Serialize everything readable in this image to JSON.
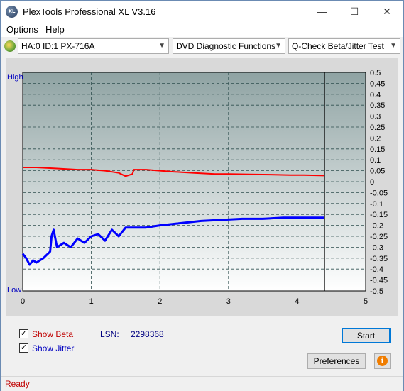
{
  "window": {
    "title": "PlexTools Professional XL V3.16",
    "icon_label": "XL",
    "minimize_glyph": "—",
    "maximize_glyph": "☐",
    "close_glyph": "✕"
  },
  "menu": {
    "options": "Options",
    "help": "Help"
  },
  "toolbar": {
    "drive": "HA:0 ID:1  PX-716A",
    "function": "DVD Diagnostic Functions",
    "test": "Q-Check Beta/Jitter Test"
  },
  "chart_data": {
    "type": "line",
    "left_axis_top_label": "High",
    "left_axis_bottom_label": "Low",
    "x_ticks": [
      "0",
      "1",
      "2",
      "3",
      "4",
      "5"
    ],
    "xlim": [
      0,
      5
    ],
    "y_ticks": [
      "0.5",
      "0.45",
      "0.4",
      "0.35",
      "0.3",
      "0.25",
      "0.2",
      "0.15",
      "0.1",
      "0.05",
      "0",
      "-0.05",
      "-0.1",
      "-0.15",
      "-0.2",
      "-0.25",
      "-0.3",
      "-0.35",
      "-0.4",
      "-0.45",
      "-0.5"
    ],
    "ylim": [
      -0.5,
      0.5
    ],
    "end_marker_x": 4.4,
    "grid": true,
    "series": [
      {
        "color": "#ff0000",
        "x": [
          0,
          0.2,
          0.5,
          0.8,
          1.0,
          1.2,
          1.4,
          1.5,
          1.6,
          1.62,
          1.8,
          2.0,
          2.2,
          2.5,
          2.8,
          3.0,
          3.3,
          3.6,
          3.9,
          4.1,
          4.4
        ],
        "y": [
          0.065,
          0.065,
          0.06,
          0.055,
          0.055,
          0.05,
          0.04,
          0.025,
          0.035,
          0.055,
          0.055,
          0.05,
          0.045,
          0.04,
          0.035,
          0.035,
          0.033,
          0.032,
          0.03,
          0.03,
          0.028
        ]
      },
      {
        "color": "#0000ff",
        "x": [
          0,
          0.05,
          0.1,
          0.15,
          0.2,
          0.3,
          0.4,
          0.42,
          0.45,
          0.5,
          0.6,
          0.7,
          0.8,
          0.9,
          1.0,
          1.1,
          1.2,
          1.3,
          1.4,
          1.5,
          1.6,
          1.8,
          2.0,
          2.3,
          2.6,
          2.9,
          3.2,
          3.5,
          3.8,
          4.1,
          4.4
        ],
        "y": [
          -0.33,
          -0.35,
          -0.38,
          -0.36,
          -0.37,
          -0.35,
          -0.32,
          -0.25,
          -0.22,
          -0.3,
          -0.28,
          -0.3,
          -0.26,
          -0.28,
          -0.25,
          -0.24,
          -0.27,
          -0.22,
          -0.25,
          -0.21,
          -0.21,
          -0.21,
          -0.2,
          -0.19,
          -0.18,
          -0.175,
          -0.17,
          -0.17,
          -0.165,
          -0.165,
          -0.165
        ]
      }
    ]
  },
  "bottom": {
    "show_beta_label": "Show Beta",
    "show_jitter_label": "Show Jitter",
    "show_beta_checked": true,
    "show_jitter_checked": true,
    "lsn_label": "LSN:",
    "lsn_value": "2298368",
    "start_button": "Start",
    "preferences_button": "Preferences",
    "info_icon": "info-icon"
  },
  "status": {
    "text": "Ready"
  },
  "colors": {
    "beta_label": "#c00000",
    "jitter_label": "#0000c0",
    "plot_top": "#8fa3a3",
    "plot_bottom": "#ffffff"
  }
}
